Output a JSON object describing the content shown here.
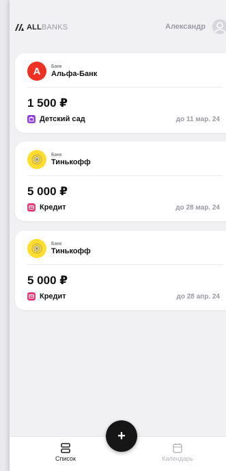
{
  "header": {
    "logo_all": "ALL",
    "logo_banks": "BANKS",
    "user_name": "Александр"
  },
  "cards": [
    {
      "bank_caption": "Банк",
      "bank_name": "Альфа-Банк",
      "bank_logo_letter": "А",
      "amount": "1 500 ₽",
      "category": "Детский сад",
      "category_icon": "kindergarten-icon",
      "category_color": "#8e3dd6",
      "due": "до 11 мар. 24"
    },
    {
      "bank_caption": "Банк",
      "bank_name": "Тинькофф",
      "amount": "5 000 ₽",
      "category": "Кредит",
      "category_icon": "credit-card-icon",
      "category_color": "#e7357a",
      "due": "до 28 мар. 24"
    },
    {
      "bank_caption": "Банк",
      "bank_name": "Тинькофф",
      "amount": "5 000 ₽",
      "category": "Кредит",
      "category_icon": "credit-card-icon",
      "category_color": "#e7357a",
      "due": "до 28 апр. 24"
    }
  ],
  "nav": {
    "list_label": "Список",
    "calendar_label": "Календарь",
    "fab_label": "+"
  },
  "colors": {
    "alfa_red": "#ef3124",
    "tinkoff_yellow": "#ffdd2d",
    "fab": "#161616"
  }
}
